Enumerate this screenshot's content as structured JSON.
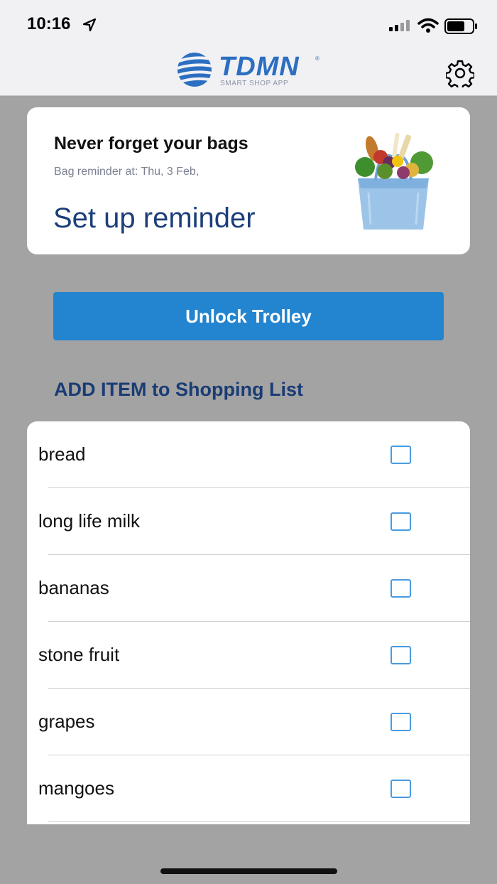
{
  "status_bar": {
    "time": "10:16"
  },
  "header": {
    "logo_text": "TDMN",
    "logo_registered": "®",
    "logo_subtitle": "SMART SHOP APP"
  },
  "reminder_card": {
    "title": "Never forget your bags",
    "subtitle": "Bag reminder at: Thu, 3 Feb,",
    "cta": "Set up reminder"
  },
  "unlock_button": {
    "label": "Unlock Trolley"
  },
  "add_item": {
    "label": "ADD ITEM to Shopping List"
  },
  "shopping_list": {
    "items": [
      {
        "label": "bread",
        "checked": false
      },
      {
        "label": "long life milk",
        "checked": false
      },
      {
        "label": "bananas",
        "checked": false
      },
      {
        "label": "stone fruit",
        "checked": false
      },
      {
        "label": "grapes",
        "checked": false
      },
      {
        "label": "mangoes",
        "checked": false
      }
    ]
  },
  "colors": {
    "accent_button": "#2384cf",
    "heading_blue": "#1a3c75",
    "background": "#a3a3a3",
    "checkbox_border": "#4a9be0"
  }
}
